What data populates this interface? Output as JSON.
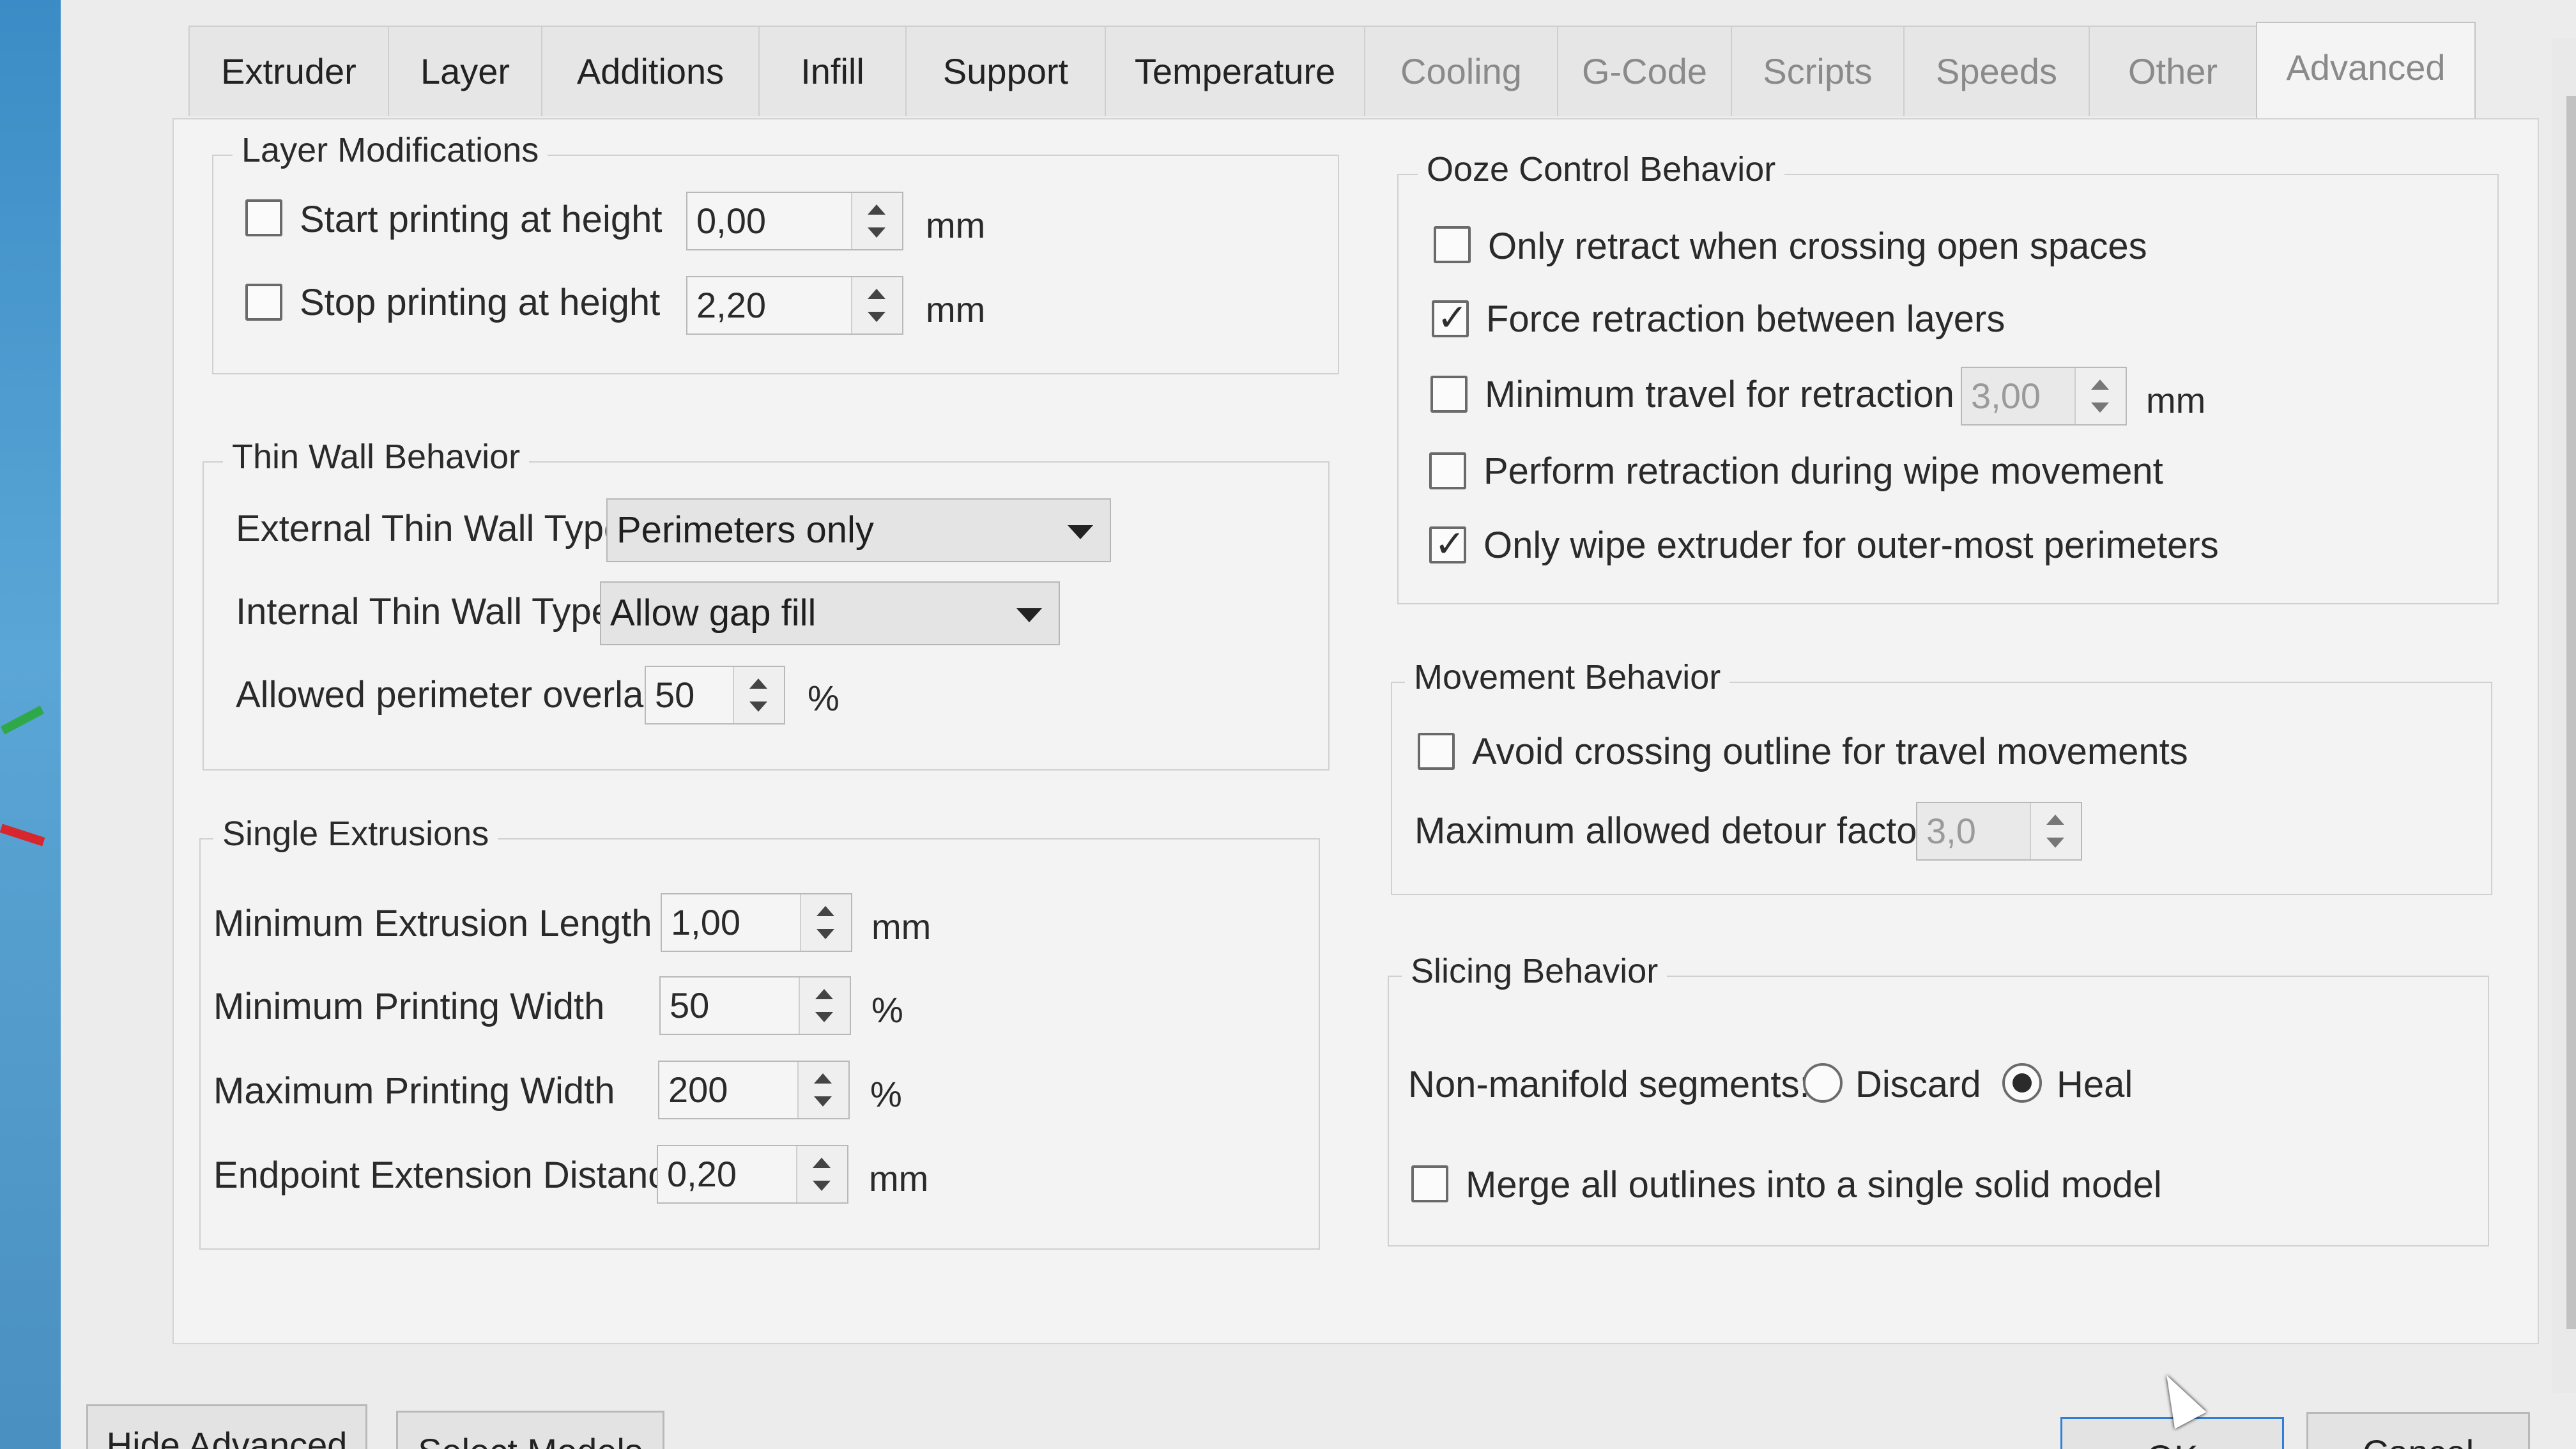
{
  "tabs": [
    {
      "label": "Extruder"
    },
    {
      "label": "Layer"
    },
    {
      "label": "Additions"
    },
    {
      "label": "Infill"
    },
    {
      "label": "Support"
    },
    {
      "label": "Temperature"
    },
    {
      "label": "Cooling"
    },
    {
      "label": "G-Code"
    },
    {
      "label": "Scripts"
    },
    {
      "label": "Speeds"
    },
    {
      "label": "Other"
    },
    {
      "label": "Advanced"
    }
  ],
  "layer_mods": {
    "title": "Layer Modifications",
    "start_label": "Start printing at height",
    "start_value": "0,00",
    "start_unit": "mm",
    "start_checked": false,
    "stop_label": "Stop printing at height",
    "stop_value": "2,20",
    "stop_unit": "mm",
    "stop_checked": false
  },
  "thin_wall": {
    "title": "Thin Wall Behavior",
    "external_label": "External Thin Wall Type",
    "external_value": "Perimeters only",
    "internal_label": "Internal Thin Wall Type",
    "internal_value": "Allow gap fill",
    "overlap_label": "Allowed perimeter overlap",
    "overlap_value": "50",
    "overlap_unit": "%"
  },
  "single_ext": {
    "title": "Single Extrusions",
    "rows": [
      {
        "label": "Minimum Extrusion Length",
        "value": "1,00",
        "unit": "mm"
      },
      {
        "label": "Minimum Printing Width",
        "value": "50",
        "unit": "%"
      },
      {
        "label": "Maximum Printing Width",
        "value": "200",
        "unit": "%"
      },
      {
        "label": "Endpoint Extension Distance",
        "value": "0,20",
        "unit": "mm"
      }
    ]
  },
  "ooze": {
    "title": "Ooze Control Behavior",
    "only_retract_label": "Only retract when crossing open spaces",
    "only_retract_checked": false,
    "force_retraction_label": "Force retraction between layers",
    "force_retraction_checked": true,
    "min_travel_label": "Minimum travel for retraction",
    "min_travel_value": "3,00",
    "min_travel_unit": "mm",
    "min_travel_checked": false,
    "wipe_retract_label": "Perform retraction during wipe movement",
    "wipe_retract_checked": false,
    "only_wipe_label": "Only wipe extruder for outer-most perimeters",
    "only_wipe_checked": true
  },
  "movement": {
    "title": "Movement Behavior",
    "avoid_label": "Avoid crossing outline for travel movements",
    "avoid_checked": false,
    "detour_label": "Maximum allowed detour factor",
    "detour_value": "3,0"
  },
  "slicing": {
    "title": "Slicing Behavior",
    "nonmanifold_label": "Non-manifold segments:",
    "discard_label": "Discard",
    "heal_label": "Heal",
    "selected": "Heal",
    "merge_label": "Merge all outlines into a single solid model",
    "merge_checked": false
  },
  "footer": {
    "hide_advanced": "Hide Advanced",
    "select_models": "Select Models",
    "ok": "OK",
    "cancel": "Cancel"
  }
}
